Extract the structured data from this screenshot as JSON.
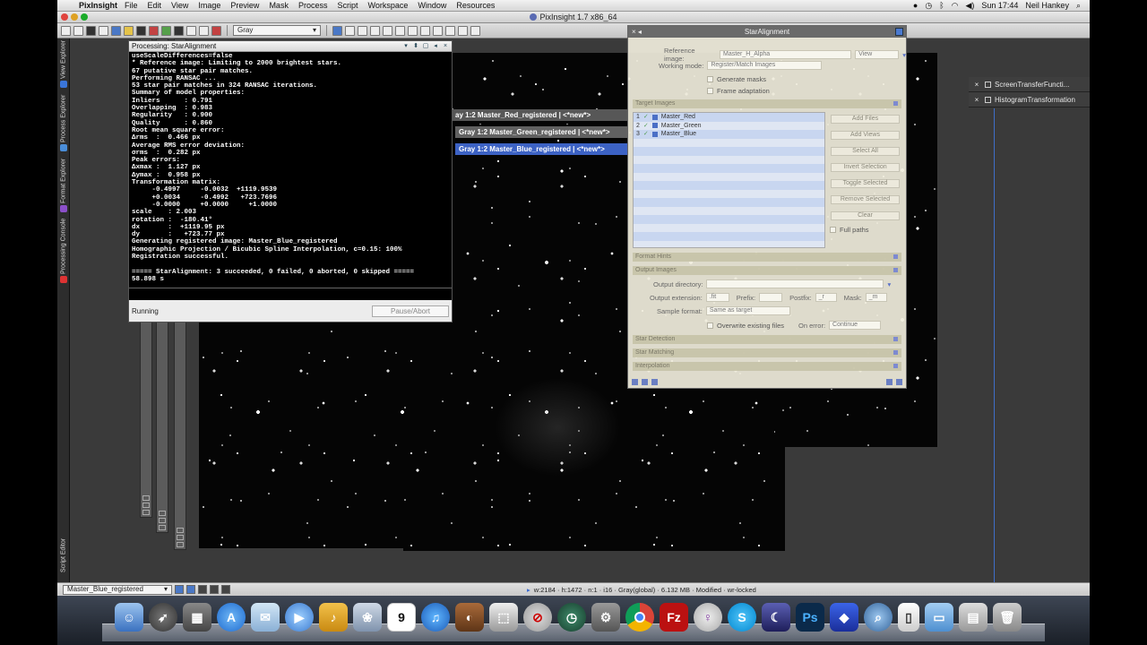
{
  "menubar": {
    "app_name": "PixInsight",
    "menus": [
      "File",
      "Edit",
      "View",
      "Image",
      "Preview",
      "Mask",
      "Process",
      "Script",
      "Workspace",
      "Window",
      "Resources"
    ],
    "clock": "Sun 17:44",
    "user": "Neil Hankey"
  },
  "window_title": "PixInsight 1.7 x86_64",
  "toolbar": {
    "colorspace": "Gray"
  },
  "sidebar_tabs": [
    "View Explorer",
    "Process Explorer",
    "Format Explorer",
    "Processing Console",
    "Script Editor"
  ],
  "image_windows": {
    "red": "ay 1:2 Master_Red_registered | <*new*>",
    "green": "Gray 1:2 Master_Green_registered | <*new*>",
    "blue": "Gray 1:2 Master_Blue_registered | <*new*>"
  },
  "right_panels": [
    "ScreenTransferFuncti...",
    "HistogramTransformation"
  ],
  "console": {
    "title": "Processing: StarAlignment",
    "lines": [
      "useScaleDifferences=false",
      "* Reference image: Limiting to 2000 brightest stars.",
      "67 putative star pair matches.",
      "Performing RANSAC ...",
      "53 star pair matches in 324 RANSAC iterations.",
      "Summary of model properties:",
      "Inliers      : 0.791",
      "Overlapping  : 0.983",
      "Regularity   : 0.900",
      "Quality      : 0.860",
      "Root mean square error:",
      "Δrms  :  0.466 px",
      "Average RMS error deviation:",
      "σrms  :  0.282 px",
      "Peak errors:",
      "Δxmax :  1.127 px",
      "Δymax :  0.958 px",
      "Transformation matrix:",
      "     -0.4997     -0.0032  +1119.9539",
      "     +0.0034     -0.4992   +723.7696",
      "     -0.0000     +0.0000     +1.0000",
      "scale    : 2.003",
      "rotation :  -180.41°",
      "dx       :  +1119.95 px",
      "dy       :   +723.77 px",
      "Generating registered image: Master_Blue_registered",
      "Homographic Projection / Bicubic Spline Interpolation, c=0.15: 100%",
      "Registration successful.",
      "",
      "===== StarAlignment: 3 succeeded, 0 failed, 0 aborted, 0 skipped =====",
      "58.898 s"
    ],
    "status": "Running",
    "pause_label": "Pause/Abort"
  },
  "star_alignment": {
    "title": "StarAlignment",
    "reference_label": "Reference image:",
    "reference_value": "Master_H_Alpha",
    "view_label": "View",
    "working_mode_label": "Working mode:",
    "working_mode_value": "Register/Match Images",
    "generate_masks": "Generate masks",
    "frame_adaptation": "Frame adaptation",
    "target_images_section": "Target Images",
    "targets": [
      {
        "index": "1",
        "name": "Master_Red"
      },
      {
        "index": "2",
        "name": "Master_Green"
      },
      {
        "index": "3",
        "name": "Master_Blue"
      }
    ],
    "buttons": [
      "Add Files",
      "Add Views",
      "Select All",
      "Invert Selection",
      "Toggle Selected",
      "Remove Selected",
      "Clear"
    ],
    "full_paths": "Full paths",
    "format_hints_section": "Format Hints",
    "output_images_section": "Output Images",
    "output_directory_label": "Output directory:",
    "output_extension_label": "Output extension:",
    "output_extension_value": ".fit",
    "prefix_label": "Prefix:",
    "postfix_label": "Postfix:",
    "postfix_value": "_r",
    "mask_label": "Mask:",
    "mask_value": "_m",
    "sample_format_label": "Sample format:",
    "sample_format_value": "Same as target",
    "overwrite_label": "Overwrite existing files",
    "on_error_label": "On error:",
    "on_error_value": "Continue",
    "star_detection_section": "Star Detection",
    "star_matching_section": "Star Matching",
    "interpolation_section": "Interpolation"
  },
  "statusbar": {
    "view": "Master_Blue_registered",
    "info": "w:2184 · h:1472 · n:1 · i16 · Gray(global) · 6.132 MB · Modified · wr-locked"
  },
  "dock": {
    "calendar_day": "9"
  }
}
